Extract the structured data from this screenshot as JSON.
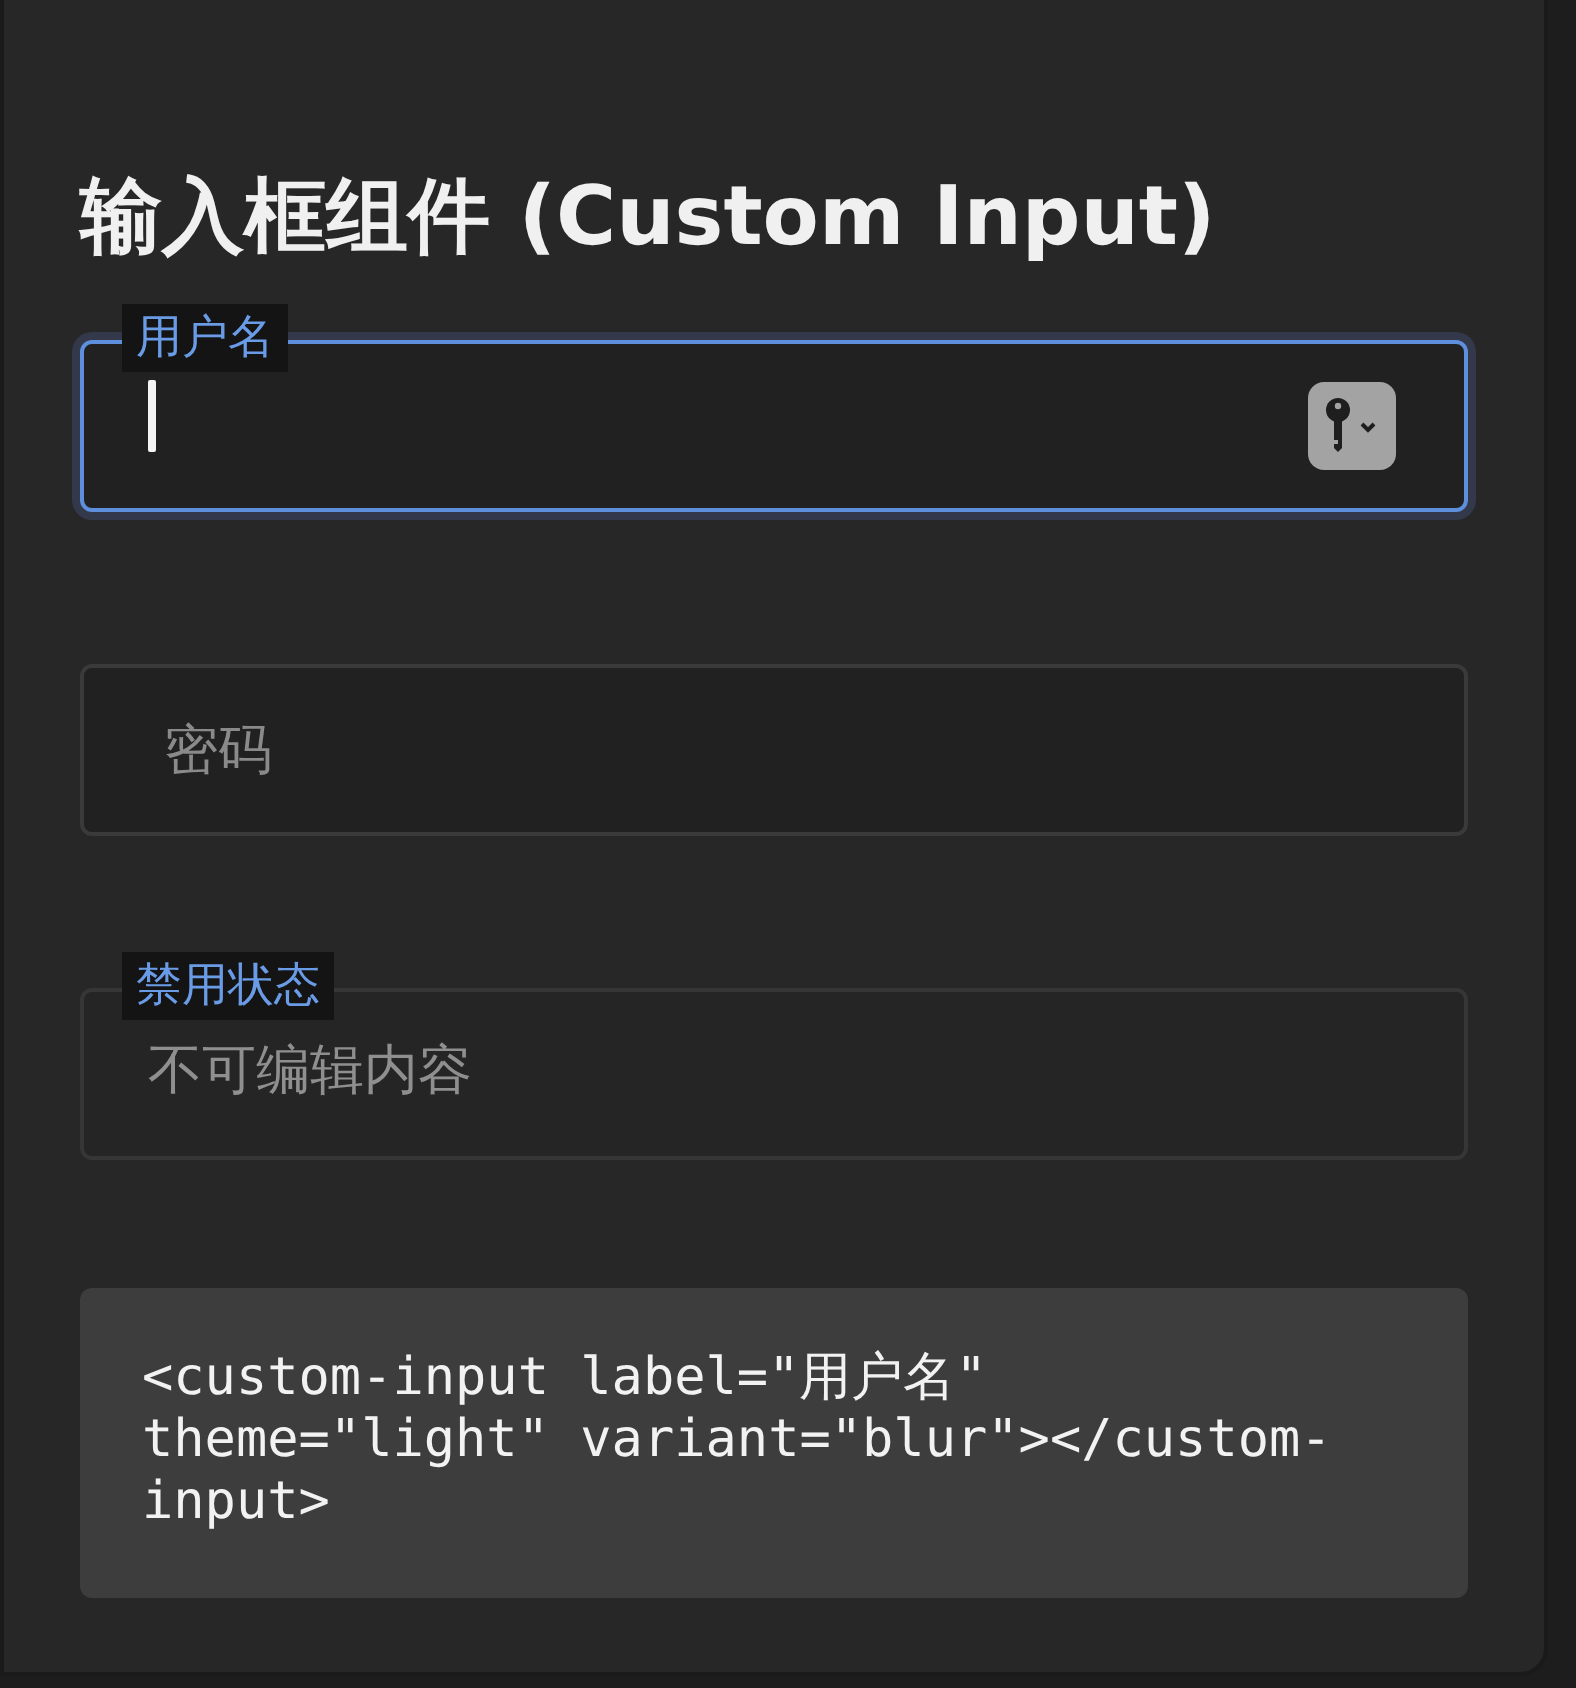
{
  "title": "输入框组件 (Custom Input)",
  "fields": [
    {
      "label": "用户名",
      "focused": true,
      "disabled": false,
      "autofill_button": true
    },
    {
      "placeholder": "密码",
      "focused": false,
      "disabled": false,
      "autofill_button": false
    },
    {
      "label": "禁用状态",
      "value": "不可编辑内容",
      "focused": false,
      "disabled": true,
      "autofill_button": false
    }
  ],
  "code_sample": "<custom-input label=\"用户名\" theme=\"light\" variant=\"blur\"></custom-input>"
}
